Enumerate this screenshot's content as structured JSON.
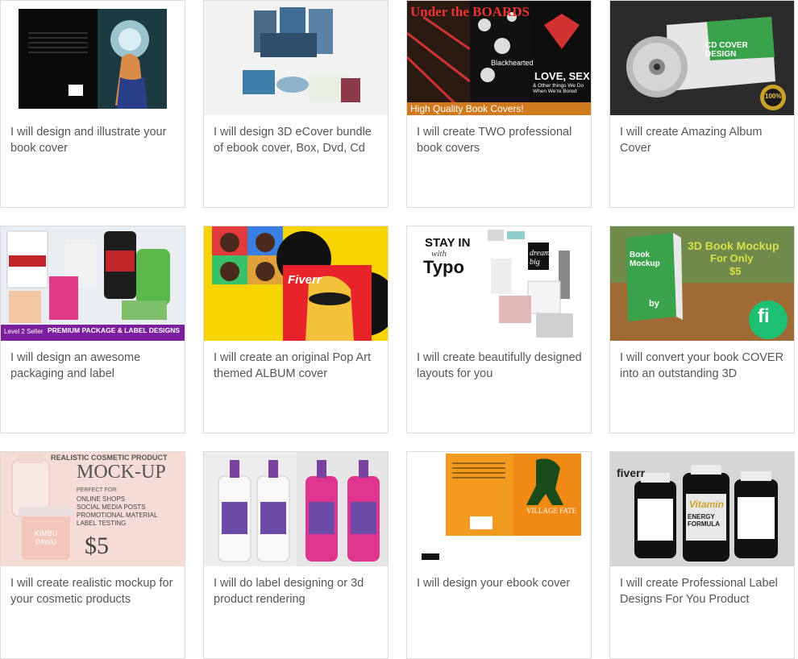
{
  "gigs": [
    {
      "title": "I will design and illustrate your book cover"
    },
    {
      "title": "I will design 3D eCover bundle of ebook cover, Box, Dvd, Cd"
    },
    {
      "title": "I will create TWO professional book covers",
      "thumb": {
        "banner": "High Quality Book Covers!",
        "h1": "Under the BOARDS",
        "h2": "Blackhearted",
        "h3": "LOVE, SEX",
        "h4": "& Other things We Do When We're Bored"
      }
    },
    {
      "title": "I will create Amazing Album Cover",
      "thumb": {
        "cd": "CD COVER DESIGN",
        "badge": "100%"
      }
    },
    {
      "title": "I will design an awesome packaging and label",
      "thumb": {
        "banner": "PREMIUM PACKAGE & LABEL DESIGNS",
        "sub": "Level 2 Seller"
      }
    },
    {
      "title": "I will create an original Pop Art themed ALBUM cover",
      "thumb": {
        "brand": "Fiverr"
      }
    },
    {
      "title": "I will create beautifully designed layouts for you",
      "thumb": {
        "h1": "STAY IN",
        "h2": "with",
        "h3": "Typo",
        "h4": "dream big"
      }
    },
    {
      "title": "I will convert your book COVER into an outstanding 3D",
      "thumb": {
        "h1": "3D Book Mockup",
        "h2": "For Only",
        "h3": "$5",
        "book1": "Book Mockup",
        "book2": "by",
        "logo": "fi"
      }
    },
    {
      "title": "I will create realistic mockup for your cosmetic products",
      "thumb": {
        "h1": "REALISTIC COSMETIC PRODUCT",
        "h2": "MOCK-UP",
        "h3": "PERFECT FOR:",
        "items": [
          "ONLINE SHOPS",
          "SOCIAL MEDIA POSTS",
          "PROMOTIONAL MATERIAL",
          "LABEL TESTING"
        ],
        "price": "$5",
        "jar": "KIMBU PAWU"
      }
    },
    {
      "title": "I will do label designing or 3d product rendering"
    },
    {
      "title": "I will design your ebook cover",
      "thumb": {
        "h1": "VILLAGE FATE"
      }
    },
    {
      "title": "I will create Professional Label Designs For You Product",
      "thumb": {
        "brand": "fiverr",
        "h1": "Vitamin",
        "h2": "ENERGY FORMULA"
      }
    }
  ]
}
